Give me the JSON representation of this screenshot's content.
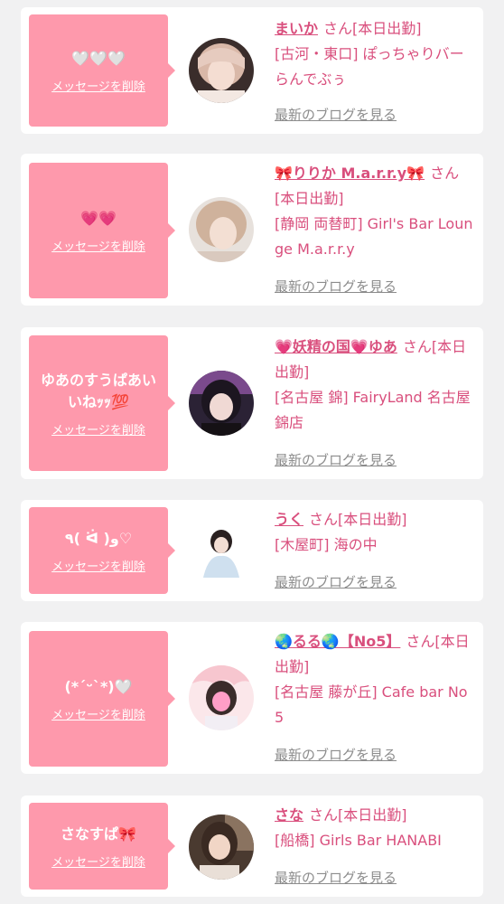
{
  "colors": {
    "accent": "#d94f7d",
    "bubble": "#fe99ac",
    "background": "#f1f1f2",
    "muted": "#8c8c8c"
  },
  "delete_label": "メッセージを削除",
  "blog_label": "最新のブログを見る",
  "san_label": "さん",
  "cards": [
    {
      "message": "🤍🤍🤍",
      "name": "まいか",
      "status": "[本日出勤]",
      "store": "[古河・東口] ぽっちゃりバー らんでぶぅ",
      "avatar_icon": "avatar-photo"
    },
    {
      "message": "💗💗",
      "name": "🎀りりか M.a.r.r.y🎀",
      "status": "[本日出勤]",
      "store": "[静岡 両替町] Girl's Bar Lounge M.a.r.r.y",
      "avatar_icon": "avatar-photo"
    },
    {
      "message": "ゆあのすうぱあいいねｯｯ💯",
      "name": "💗妖精の国💗ゆあ",
      "status": "[本日出勤]",
      "store": "[名古屋 錦] FairyLand 名古屋錦店",
      "avatar_icon": "avatar-photo"
    },
    {
      "message": "٩( ᐛ )و♡",
      "name": "うく",
      "status": "[本日出勤]",
      "store": "[木屋町] 海の中",
      "avatar_icon": "avatar-photo"
    },
    {
      "message": "(*ˊᵕˋ*)🤍",
      "name": "🌏るる🌏【No5】",
      "status": "[本日出勤]",
      "store": "[名古屋 藤が丘] Cafe bar No5",
      "avatar_icon": "avatar-photo"
    },
    {
      "message": "さなすぱ🎀",
      "name": "さな",
      "status": "[本日出勤]",
      "store": "[船橋] Girls Bar HANABI",
      "avatar_icon": "avatar-photo"
    }
  ]
}
